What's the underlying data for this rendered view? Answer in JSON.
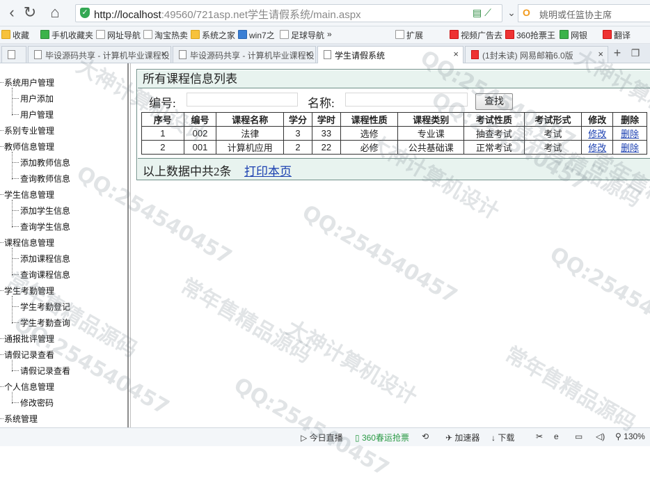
{
  "browser": {
    "url_host": "http://localhost",
    "url_rest": ":49560/721asp.net学生请假系统/main.aspx",
    "search_placeholder": "姚明或任篮协主席",
    "favorites": [
      "收藏",
      "手机收藏夹",
      "网址导航",
      "淘宝热卖",
      "系统之家",
      "win7之",
      "足球导航",
      "»",
      "扩展",
      "视频广告去",
      "360抢票王",
      "网银",
      "翻译"
    ],
    "tabs": [
      {
        "title": "毕设源码共享 - 计算机毕业课程设",
        "active": false
      },
      {
        "title": "毕设源码共享 - 计算机毕业课程设",
        "active": false
      },
      {
        "title": "学生请假系统",
        "active": true
      },
      {
        "title": "(1封未读) 网易邮箱6.0版",
        "active": false
      }
    ],
    "zoom": "130%"
  },
  "sidebar": {
    "groups": [
      {
        "label": "系统用户管理",
        "children": [
          "用户添加",
          "用户管理"
        ]
      },
      {
        "label": "系别专业管理",
        "children": []
      },
      {
        "label": "教师信息管理",
        "children": [
          "添加教师信息",
          "查询教师信息"
        ]
      },
      {
        "label": "学生信息管理",
        "children": [
          "添加学生信息",
          "查询学生信息"
        ]
      },
      {
        "label": "课程信息管理",
        "children": [
          "添加课程信息",
          "查询课程信息"
        ]
      },
      {
        "label": "学生考勤管理",
        "children": [
          "学生考勤登记",
          "学生考勤查询"
        ]
      },
      {
        "label": "通报批评管理",
        "children": []
      },
      {
        "label": "请假记录查看",
        "children": [
          "请假记录查看"
        ]
      },
      {
        "label": "个人信息管理",
        "children": [
          "修改密码"
        ]
      },
      {
        "label": "系统管理",
        "children": []
      }
    ]
  },
  "main": {
    "title": "所有课程信息列表",
    "search": {
      "code_label": "编号:",
      "name_label": "名称:",
      "code_value": "",
      "name_value": "",
      "button": "查找"
    },
    "columns": [
      "序号",
      "编号",
      "课程名称",
      "学分",
      "学时",
      "课程性质",
      "课程类别",
      "考试性质",
      "考试形式",
      "修改",
      "删除"
    ],
    "rows": [
      [
        "1",
        "002",
        "法律",
        "3",
        "33",
        "选修",
        "专业课",
        "抽查考试",
        "考试",
        "修改",
        "删除"
      ],
      [
        "2",
        "001",
        "计算机应用",
        "2",
        "22",
        "必修",
        "公共基础课",
        "正常考试",
        "考试",
        "修改",
        "删除"
      ]
    ],
    "footer_text": "以上数据中共2条",
    "print_link": "打印本页"
  },
  "status": {
    "live": "今日直播",
    "ticket": "360春运抢票",
    "accel": "加速器",
    "download": "下载"
  },
  "watermark": {
    "lines": [
      "QQ:254540457",
      "大神计算机设计",
      "常年售精品源码"
    ]
  },
  "colors": {
    "panel_bg": "#e8f3ef",
    "link": "#1a3fb0",
    "border": "#6f8f88"
  }
}
